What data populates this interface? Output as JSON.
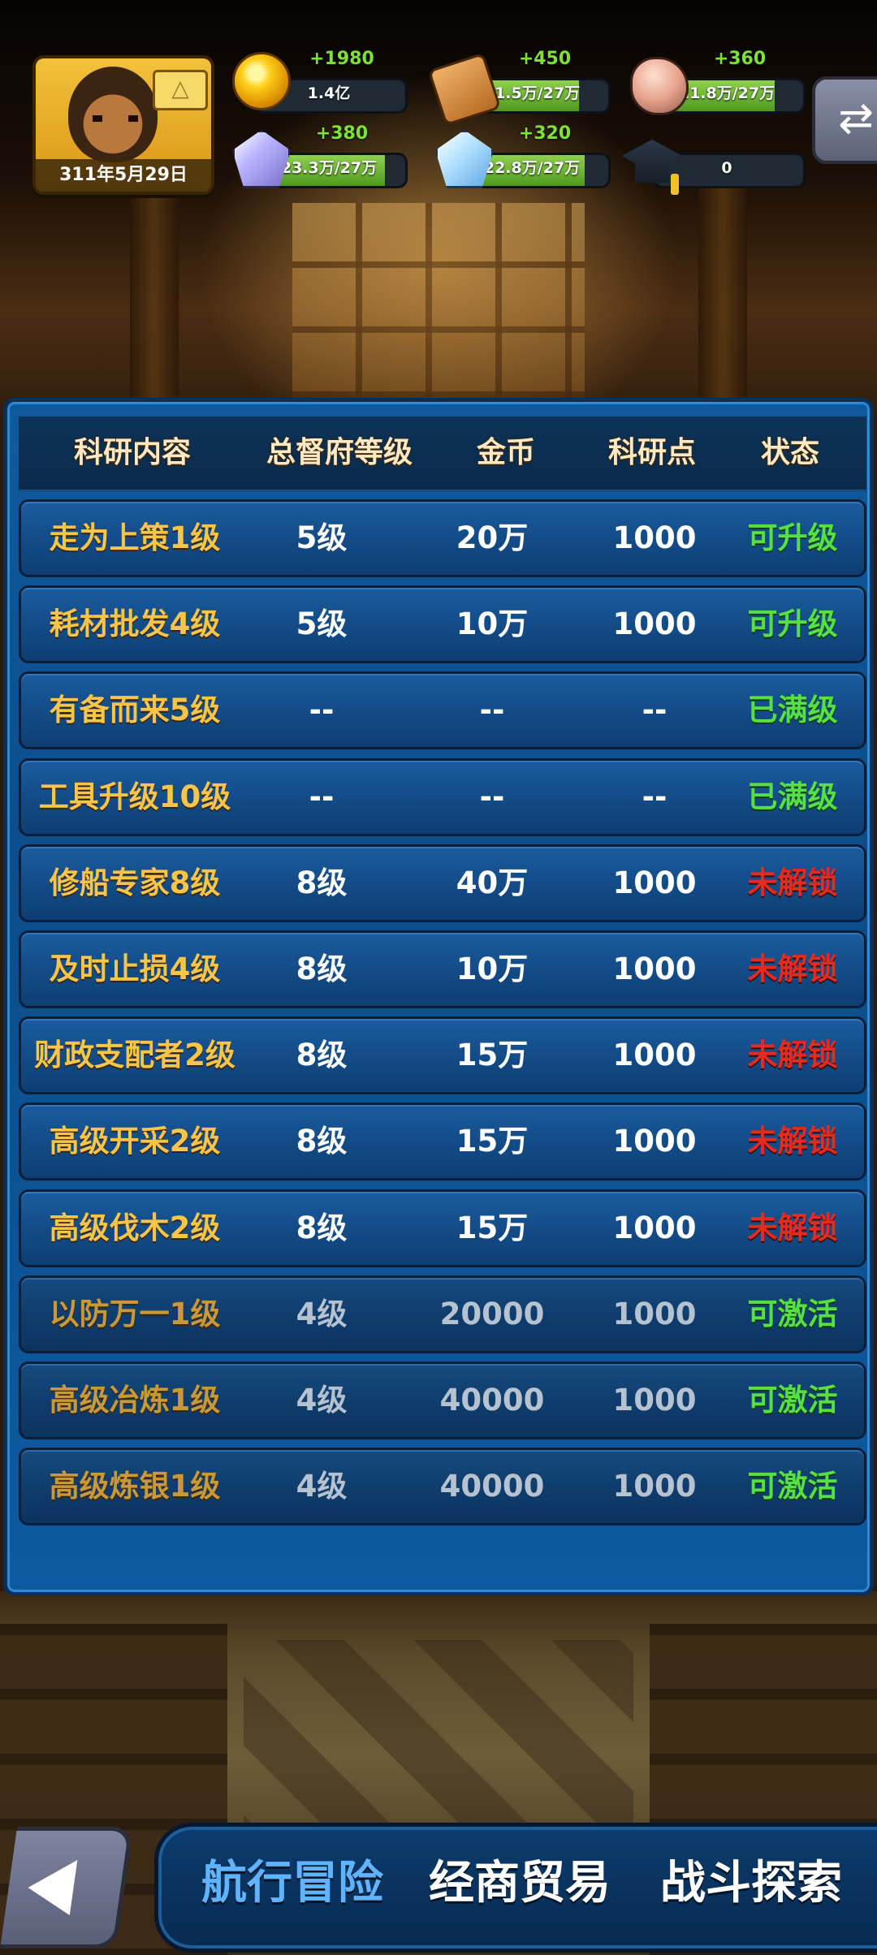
{
  "hud": {
    "date": "311年5月29日",
    "resources": [
      {
        "id": "gold",
        "icon": "gold-coin-icon",
        "gain": "+1980",
        "value": "1.4亿",
        "fill": 0
      },
      {
        "id": "wood",
        "icon": "wood-plank-icon",
        "gain": "+450",
        "value": "21.5万/27万",
        "fill": 0.8
      },
      {
        "id": "stone",
        "icon": "stone-ore-icon",
        "gain": "+360",
        "value": "21.8万/27万",
        "fill": 0.81
      },
      {
        "id": "crystal",
        "icon": "purple-crystal-icon",
        "gain": "+380",
        "value": "23.3万/27万",
        "fill": 0.86
      },
      {
        "id": "ice",
        "icon": "blue-crystal-icon",
        "gain": "+320",
        "value": "22.8万/27万",
        "fill": 0.84
      },
      {
        "id": "research",
        "icon": "graduation-cap-icon",
        "gain": "",
        "value": "0",
        "fill": 0
      }
    ]
  },
  "table": {
    "headers": [
      "科研内容",
      "总督府等级",
      "金币",
      "科研点",
      "状态"
    ],
    "rows": [
      {
        "name": "走为上策1级",
        "level": "5级",
        "gold": "20万",
        "points": "1000",
        "status": "可升级",
        "status_color": "#57e043",
        "dim": false
      },
      {
        "name": "耗材批发4级",
        "level": "5级",
        "gold": "10万",
        "points": "1000",
        "status": "可升级",
        "status_color": "#57e043",
        "dim": false
      },
      {
        "name": "有备而来5级",
        "level": "--",
        "gold": "--",
        "points": "--",
        "status": "已满级",
        "status_color": "#57e043",
        "dim": false
      },
      {
        "name": "工具升级10级",
        "level": "--",
        "gold": "--",
        "points": "--",
        "status": "已满级",
        "status_color": "#57e043",
        "dim": false
      },
      {
        "name": "修船专家8级",
        "level": "8级",
        "gold": "40万",
        "points": "1000",
        "status": "未解锁",
        "status_color": "#e42b1f",
        "dim": false
      },
      {
        "name": "及时止损4级",
        "level": "8级",
        "gold": "10万",
        "points": "1000",
        "status": "未解锁",
        "status_color": "#e42b1f",
        "dim": false
      },
      {
        "name": "财政支配者2级",
        "level": "8级",
        "gold": "15万",
        "points": "1000",
        "status": "未解锁",
        "status_color": "#e42b1f",
        "dim": false
      },
      {
        "name": "高级开采2级",
        "level": "8级",
        "gold": "15万",
        "points": "1000",
        "status": "未解锁",
        "status_color": "#e42b1f",
        "dim": false
      },
      {
        "name": "高级伐木2级",
        "level": "8级",
        "gold": "15万",
        "points": "1000",
        "status": "未解锁",
        "status_color": "#e42b1f",
        "dim": false
      },
      {
        "name": "以防万一1级",
        "level": "4级",
        "gold": "20000",
        "points": "1000",
        "status": "可激活",
        "status_color": "#57e043",
        "dim": true
      },
      {
        "name": "高级冶炼1级",
        "level": "4级",
        "gold": "40000",
        "points": "1000",
        "status": "可激活",
        "status_color": "#57e043",
        "dim": true
      },
      {
        "name": "高级炼银1级",
        "level": "4级",
        "gold": "40000",
        "points": "1000",
        "status": "可激活",
        "status_color": "#57e043",
        "dim": true
      }
    ]
  },
  "nav": {
    "tabs": [
      {
        "label": "航行冒险",
        "active": true
      },
      {
        "label": "经商贸易",
        "active": false
      },
      {
        "label": "战斗探索",
        "active": false
      }
    ]
  },
  "colors": {
    "panel": "#0c4d8a",
    "header_text": "#ffe9c2",
    "name_text": "#f6c54a",
    "status_green": "#57e043",
    "status_red": "#e42b1f",
    "nav_active": "#5fb3ff"
  }
}
